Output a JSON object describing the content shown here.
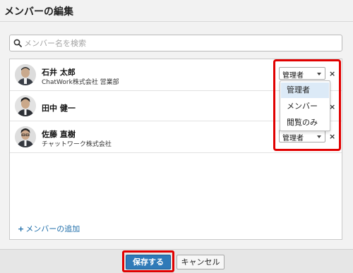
{
  "dialog": {
    "title": "メンバーの編集"
  },
  "search": {
    "placeholder": "メンバー名を検索",
    "icon": "search-icon"
  },
  "members": [
    {
      "name": "石井 太郎",
      "org": "ChatWork株式会社 営業部",
      "role": "管理者"
    },
    {
      "name": "田中 健一",
      "org": "",
      "role": ""
    },
    {
      "name": "佐藤 直樹",
      "org": "チャットワーク株式会社",
      "role": "管理者"
    }
  ],
  "remove_symbol": "×",
  "role_dropdown": {
    "options": [
      "管理者",
      "メンバー",
      "閲覧のみ"
    ],
    "selected_index": 0
  },
  "add_member": {
    "plus": "+",
    "label": "メンバーの追加"
  },
  "footer": {
    "save_label": "保存する",
    "cancel_label": "キャンセル"
  },
  "colors": {
    "highlight": "#e10000",
    "primary_button": "#2f7ab8",
    "link": "#1f6eaa",
    "dropdown_selected": "#dceaf7"
  }
}
